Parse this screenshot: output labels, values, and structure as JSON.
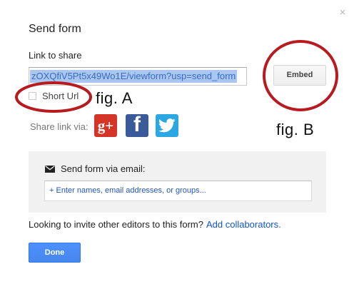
{
  "dialog": {
    "title": "Send form",
    "close_symbol": "×",
    "link_label": "Link to share",
    "link_value": "zOXQfiV5Pt5x49Wo1E/viewform?usp=send_form",
    "embed_label": "Embed",
    "short_url_label": "Short Url",
    "short_url_checked": false,
    "share_label": "Share link via:",
    "social": [
      {
        "icon": "google-plus-icon",
        "glyph": "g+",
        "color": "#d53526"
      },
      {
        "icon": "facebook-icon",
        "glyph": "f",
        "color": "#3b5a99"
      },
      {
        "icon": "twitter-icon",
        "glyph": "bird",
        "color": "#2ba8e2"
      }
    ],
    "email_heading": "Send form via email:",
    "email_icon": "envelope-icon",
    "email_placeholder": "+ Enter names, email addresses, or groups...",
    "invite_text": "Looking to invite other editors to this form?",
    "invite_link": "Add collaborators.",
    "done_label": "Done"
  },
  "annotations": {
    "fig_a": "fig. A",
    "fig_b": "fig. B",
    "circle_color": "#b81b1f"
  },
  "colors": {
    "primary_button": "#4d90fe",
    "link": "#1155cc",
    "selection": "#a9c7f0"
  }
}
